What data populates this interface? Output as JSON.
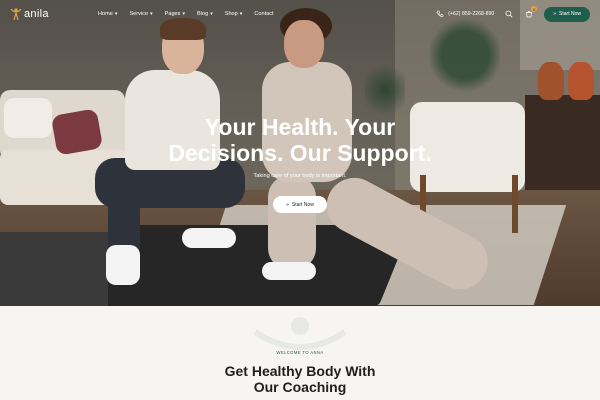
{
  "brand": {
    "name": "anila",
    "accent": "#1f5d4c",
    "logo_icon": "person-arms-up-logo"
  },
  "nav": {
    "items": [
      {
        "label": "Home",
        "has_dropdown": true
      },
      {
        "label": "Service",
        "has_dropdown": true
      },
      {
        "label": "Pages",
        "has_dropdown": true
      },
      {
        "label": "Blog",
        "has_dropdown": true
      },
      {
        "label": "Shop",
        "has_dropdown": true
      },
      {
        "label": "Contact",
        "has_dropdown": false
      }
    ],
    "phone": "(+62) 859-2268-890",
    "cta_label": "Start Now",
    "cart_count": "0"
  },
  "hero": {
    "title_line1": "Your Health. Your",
    "title_line2": "Decisions. Our Support.",
    "subtitle": "Taking care of your body is important.",
    "cta_label": "Start Now"
  },
  "welcome": {
    "eyebrow": "WELCOME TO ANNA",
    "title_line1": "Get Healthy Body With",
    "title_line2": "Our Coaching"
  },
  "colors": {
    "cta_dark": "#1f5d4c",
    "badge": "#e6a23c",
    "hero_text": "#ffffff",
    "page_bg": "#f7f5f2"
  }
}
